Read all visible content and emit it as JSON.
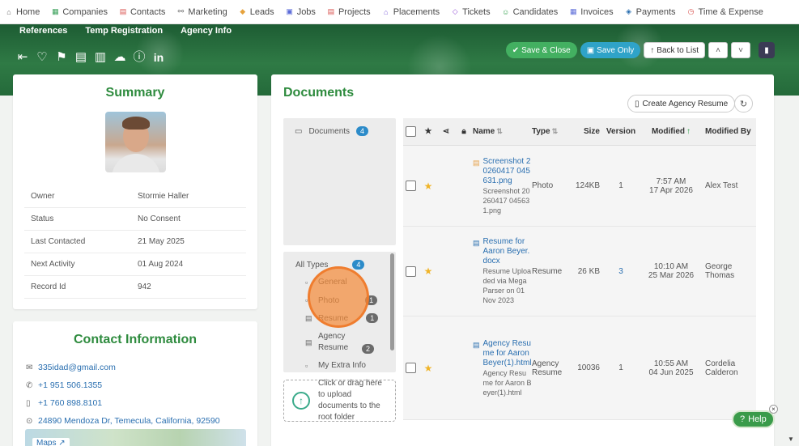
{
  "topnav": {
    "items": [
      {
        "label": "Home",
        "icon": "home-icon",
        "glyph": "⌂",
        "color": "#666666"
      },
      {
        "label": "Companies",
        "icon": "building-icon",
        "glyph": "▦",
        "color": "#3aa05a"
      },
      {
        "label": "Contacts",
        "icon": "contacts-icon",
        "glyph": "▤",
        "color": "#d9534f"
      },
      {
        "label": "Marketing",
        "icon": "marketing-icon",
        "glyph": "⚯",
        "color": "#666666"
      },
      {
        "label": "Leads",
        "icon": "leads-icon",
        "glyph": "◆",
        "color": "#e6a23c"
      },
      {
        "label": "Jobs",
        "icon": "jobs-icon",
        "glyph": "▣",
        "color": "#5b6bd8"
      },
      {
        "label": "Projects",
        "icon": "projects-icon",
        "glyph": "▤",
        "color": "#d9534f"
      },
      {
        "label": "Placements",
        "icon": "placements-icon",
        "glyph": "⌂",
        "color": "#7a5bd8"
      },
      {
        "label": "Tickets",
        "icon": "tickets-icon",
        "glyph": "◇",
        "color": "#9a5bd8"
      },
      {
        "label": "Candidates",
        "icon": "candidates-icon",
        "glyph": "☺",
        "color": "#2e9e4a"
      },
      {
        "label": "Invoices",
        "icon": "invoices-icon",
        "glyph": "▦",
        "color": "#5b6bd8"
      },
      {
        "label": "Payments",
        "icon": "payments-icon",
        "glyph": "◈",
        "color": "#2a6fb0"
      },
      {
        "label": "Time & Expense",
        "icon": "clock-icon",
        "glyph": "◷",
        "color": "#d9534f"
      }
    ]
  },
  "subnav": {
    "items": [
      "References",
      "Temp Registration",
      "Agency Info"
    ]
  },
  "actions": {
    "save_close": "Save & Close",
    "save_only": "Save Only",
    "back_to_list": "Back to List"
  },
  "summary": {
    "title": "Summary",
    "fields": [
      {
        "key": "Owner",
        "value": "Stormie Haller"
      },
      {
        "key": "Status",
        "value": "No Consent"
      },
      {
        "key": "Last Contacted",
        "value": "21 May 2025"
      },
      {
        "key": "Next Activity",
        "value": "01 Aug 2024"
      },
      {
        "key": "Record Id",
        "value": "942"
      }
    ]
  },
  "contact": {
    "title": "Contact Information",
    "email": "335idad@gmail.com",
    "phone1": "+1 951 506.1355",
    "phone2": "+1 760 898.8101",
    "address": "24890 Mendoza Dr, Temecula, California, 92590",
    "maps_label": "Maps"
  },
  "documents": {
    "title": "Documents",
    "create_label": "Create Agency Resume",
    "folder": {
      "label": "Documents",
      "count": "4"
    },
    "types": {
      "all_label": "All Types",
      "all_count": "4",
      "items": [
        {
          "label": "General",
          "count": ""
        },
        {
          "label": "Photo",
          "count": "1"
        },
        {
          "label": "Resume",
          "count": "1"
        },
        {
          "label": "Agency Resume",
          "count": "2"
        },
        {
          "label": "My Extra Info",
          "count": ""
        }
      ]
    },
    "upload_text": "Click or drag here to upload documents to the root folder",
    "columns": {
      "name": "Name",
      "type": "Type",
      "size": "Size",
      "version": "Version",
      "modified": "Modified",
      "modified_by": "Modified By"
    },
    "rows": [
      {
        "file_icon": "image-file-icon",
        "name": "Screenshot 20260417 045631.png",
        "description": "Screenshot 20260417 045631.png",
        "type": "Photo",
        "size": "124KB",
        "version": "1",
        "modified_time": "7:57 AM",
        "modified_date": "17 Apr 2026",
        "modified_by": "Alex Test"
      },
      {
        "file_icon": "doc-file-icon",
        "name": "Resume for Aaron Beyer.docx",
        "description": "Resume Uploaded via Mega Parser on 01 Nov 2023",
        "type": "Resume",
        "size": "26 KB",
        "version": "3",
        "modified_time": "10:10 AM",
        "modified_date": "25 Mar 2026",
        "modified_by": "George Thomas"
      },
      {
        "file_icon": "doc-file-icon",
        "name": "Agency Resume for Aaron Beyer(1).html",
        "description": "Agency Resume for Aaron Beyer(1).html",
        "type": "Agency Resume",
        "size": "10036",
        "version": "1",
        "modified_time": "10:55 AM",
        "modified_date": "04 Jun 2025",
        "modified_by": "Cordelia Calderon"
      }
    ]
  },
  "help": {
    "label": "Help"
  },
  "colors": {
    "brand_green": "#2e8b3e",
    "link_blue": "#2a6fb0",
    "badge_blue": "#2c8bc9"
  }
}
